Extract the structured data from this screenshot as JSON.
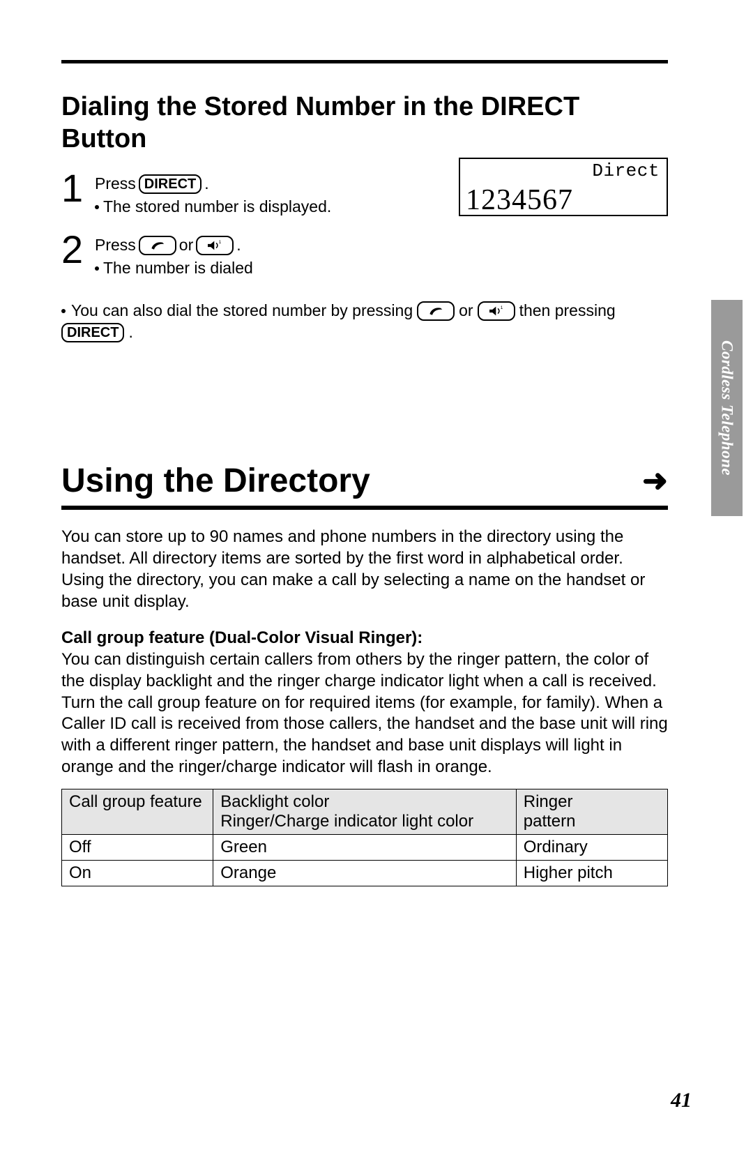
{
  "subheading": "Dialing the Stored Number in the DIRECT Button",
  "steps": [
    {
      "number": "1",
      "line_pre": "Press",
      "button": "DIRECT",
      "line_post": ".",
      "bullet": "The stored number is displayed."
    },
    {
      "number": "2",
      "line_pre": "Press",
      "line_mid": "or",
      "line_post": ".",
      "bullet": "The number is dialed"
    }
  ],
  "lcd": {
    "label": "Direct",
    "number": "1234567"
  },
  "note": {
    "pre": "You can also dial the stored number by pressing",
    "mid": "or",
    "post": "then pressing",
    "button": "DIRECT",
    "end": "."
  },
  "section_title": "Using the Directory",
  "intro_para": "You can store up to 90 names and phone numbers in the directory using the handset. All directory items are sorted by the first word in alphabetical order. Using the directory, you can make a call by selecting a name on the handset or base unit display.",
  "feature_heading": "Call group feature (Dual-Color Visual Ringer):",
  "feature_para": "You can distinguish certain callers from others by the ringer pattern, the color of the display backlight and the ringer charge indicator light when a call is received. Turn the call group feature on for required items (for example, for family). When a Caller ID call is received from those callers, the handset and the base unit will ring with a different ringer pattern, the handset and base unit displays will light in orange and the ringer/charge indicator will flash in orange.",
  "table": {
    "headers": [
      "Call group feature",
      "Backlight color\nRinger/Charge indicator light color",
      "Ringer\npattern"
    ],
    "rows": [
      [
        "Off",
        "Green",
        "Ordinary"
      ],
      [
        "On",
        "Orange",
        "Higher pitch"
      ]
    ]
  },
  "side_tab": "Cordless Telephone",
  "page_number": "41"
}
